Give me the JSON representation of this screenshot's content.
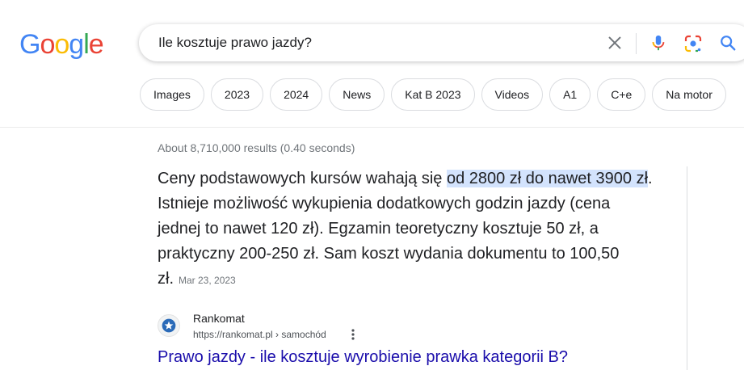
{
  "logo": {
    "letters": [
      {
        "ch": "G",
        "color": "#4285F4"
      },
      {
        "ch": "o",
        "color": "#EA4335"
      },
      {
        "ch": "o",
        "color": "#FBBC05"
      },
      {
        "ch": "g",
        "color": "#4285F4"
      },
      {
        "ch": "l",
        "color": "#34A853"
      },
      {
        "ch": "e",
        "color": "#EA4335"
      }
    ]
  },
  "search": {
    "query": "Ile kosztuje prawo jazdy?",
    "icons": [
      "clear-icon",
      "mic-icon",
      "lens-icon",
      "search-icon"
    ]
  },
  "chips": [
    "Images",
    "2023",
    "2024",
    "News",
    "Kat B 2023",
    "Videos",
    "A1",
    "C+e",
    "Na motor"
  ],
  "results_stats": "About 8,710,000 results (0.40 seconds)",
  "featured_snippet": {
    "before": "Ceny podstawowych kursów wahają się ",
    "highlight": "od 2800 zł do nawet 3900 zł",
    "after": ". Istnieje możliwość wykupienia dodatkowych godzin jazdy (cena jednej to nawet 120 zł). Egzamin teoretyczny kosztuje 50 zł, a praktyczny 200-250 zł. Sam koszt wydania dokumentu to 100,50 zł.",
    "date": "Mar 23, 2023"
  },
  "source": {
    "name": "Rankomat",
    "url": "https://rankomat.pl › samochód",
    "title": "Prawo jazdy - ile kosztuje wyrobienie prawka kategorii B?"
  },
  "colors": {
    "link": "#1a0dab",
    "highlight": "#d3e3fd",
    "secondary_text": "#70757a"
  }
}
